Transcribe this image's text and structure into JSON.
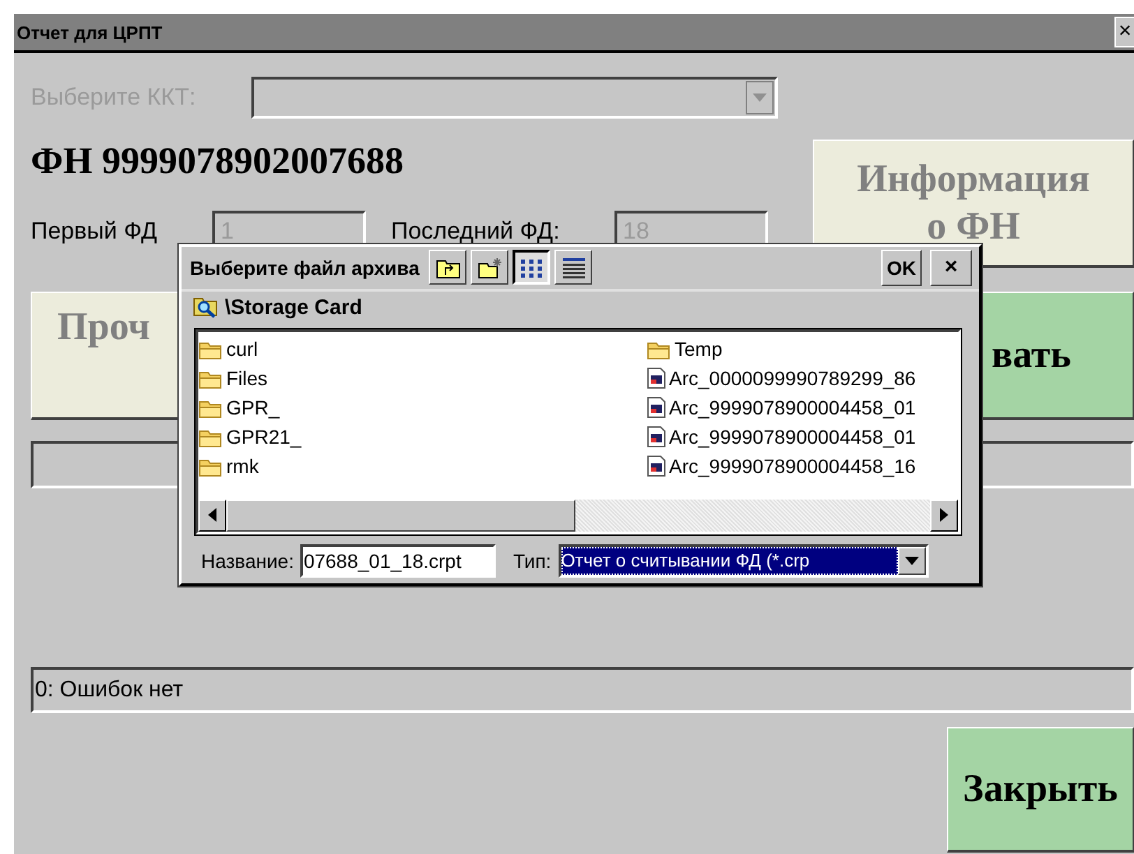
{
  "window": {
    "title": "Отчет для ЦРПТ",
    "close": "×"
  },
  "kkt": {
    "label": "Выберите ККТ:",
    "disabled": true
  },
  "fn_title": "ФН 9999078902007688",
  "info_button": "Информация о ФН",
  "first_fd": {
    "label": "Первый ФД",
    "value": "1"
  },
  "last_fd": {
    "label": "Последний ФД:",
    "value": "18"
  },
  "read_button": "Проч",
  "form_button": "вать",
  "status": "0: Ошибок нет",
  "close_button": "Закрыть",
  "dialog": {
    "title": "Выберите файл архива",
    "views": [
      {
        "kind": "list",
        "selected": true
      },
      {
        "kind": "details",
        "selected": false
      }
    ],
    "ok": "OK",
    "close": "×",
    "path": "\\Storage Card",
    "columns": [
      [
        {
          "kind": "folder",
          "name": "curl"
        },
        {
          "kind": "folder",
          "name": "Files"
        },
        {
          "kind": "folder",
          "name": "GPR_"
        },
        {
          "kind": "folder",
          "name": "GPR21_"
        },
        {
          "kind": "folder",
          "name": "rmk"
        }
      ],
      [
        {
          "kind": "folder",
          "name": "Temp"
        },
        {
          "kind": "file",
          "name": "Arc_0000099990789299_86"
        },
        {
          "kind": "file",
          "name": "Arc_9999078900004458_01"
        },
        {
          "kind": "file",
          "name": "Arc_9999078900004458_01"
        },
        {
          "kind": "file",
          "name": "Arc_9999078900004458_16"
        }
      ]
    ],
    "name_label": "Название:",
    "name_value": "07688_01_18.crpt",
    "type_label": "Тип:",
    "type_value": "Отчет о считывании ФД (*.crp",
    "type_highlighted": true
  }
}
